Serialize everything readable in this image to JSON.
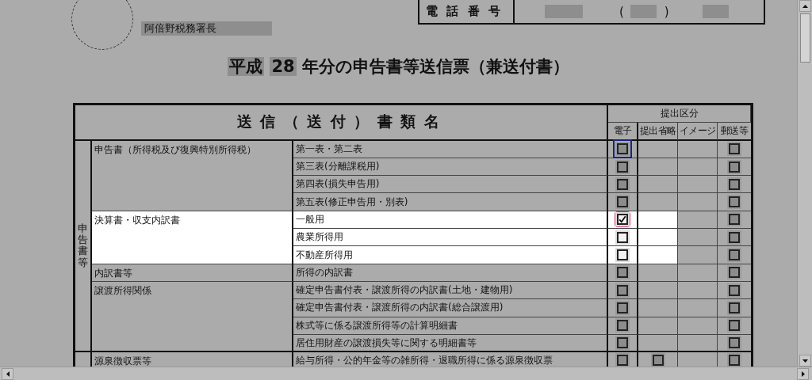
{
  "header": {
    "office": "阿倍野税務署長",
    "phone_label": "電話番号",
    "phone_open": "(",
    "phone_close": ")"
  },
  "title": {
    "era": "平成",
    "year": "28",
    "text": "年分の申告書等送信票（兼送付書）"
  },
  "table": {
    "name_header": "送信（送付）書類名",
    "submission_header": "提出区分",
    "columns": [
      "電子",
      "提出省略",
      "イメージ",
      "郵送等"
    ],
    "groups": [
      {
        "label": "申告書等",
        "categories": [
          {
            "name": "申告書（所得税及び復興特別所得税）",
            "highlighted": false,
            "rows": [
              {
                "name": "第一表・第二表",
                "e_filing": {
                  "checked": false,
                  "cursor": true,
                  "marked": false
                },
                "mail": {
                  "checked": false
                }
              },
              {
                "name": "第三表(分離課税用)",
                "e_filing": {
                  "checked": false,
                  "cursor": false,
                  "marked": false
                },
                "mail": {
                  "checked": false
                }
              },
              {
                "name": "第四表(損失申告用)",
                "e_filing": {
                  "checked": false,
                  "cursor": false,
                  "marked": false
                },
                "mail": {
                  "checked": false
                }
              },
              {
                "name": "第五表(修正申告用・別表)",
                "e_filing": {
                  "checked": false,
                  "cursor": false,
                  "marked": false
                },
                "mail": {
                  "checked": false
                }
              }
            ]
          },
          {
            "name": "決算書・収支内訳書",
            "highlighted": true,
            "rows": [
              {
                "name": "一般用",
                "e_filing": {
                  "checked": true,
                  "cursor": false,
                  "marked": true
                },
                "mail": {
                  "checked": false
                }
              },
              {
                "name": "農業所得用",
                "e_filing": {
                  "checked": false,
                  "cursor": false,
                  "marked": false
                },
                "mail": {
                  "checked": false
                }
              },
              {
                "name": "不動産所得用",
                "e_filing": {
                  "checked": false,
                  "cursor": false,
                  "marked": false
                },
                "mail": {
                  "checked": false
                }
              }
            ]
          },
          {
            "name": "内訳書等",
            "highlighted": false,
            "rows": [
              {
                "name": "所得の内訳書",
                "e_filing": {
                  "checked": false,
                  "cursor": false,
                  "marked": false
                },
                "mail": {
                  "checked": false
                }
              }
            ]
          },
          {
            "name": "譲渡所得関係",
            "highlighted": false,
            "rows": [
              {
                "name": "確定申告書付表・譲渡所得の内訳書(土地・建物用)",
                "e_filing": {
                  "checked": false,
                  "cursor": false,
                  "marked": false
                },
                "mail": {
                  "checked": false
                }
              },
              {
                "name": "確定申告書付表・譲渡所得の内訳書(総合譲渡用)",
                "e_filing": {
                  "checked": false,
                  "cursor": false,
                  "marked": false
                },
                "mail": {
                  "checked": false
                }
              },
              {
                "name": "株式等に係る譲渡所得等の計算明細書",
                "e_filing": {
                  "checked": false,
                  "cursor": false,
                  "marked": false
                },
                "mail": {
                  "checked": false
                }
              },
              {
                "name": "居住用財産の譲渡損失等に関する明細書等",
                "e_filing": {
                  "checked": false,
                  "cursor": false,
                  "marked": false
                },
                "mail": {
                  "checked": false
                }
              }
            ]
          }
        ]
      },
      {
        "categories": [
          {
            "name": "源泉徴収票等",
            "highlighted": false,
            "rows": [
              {
                "name": "給与所得・公的年金等の雑所得・退職所得に係る源泉徴収票",
                "e_filing": {
                  "checked": false,
                  "cursor": false,
                  "marked": false
                },
                "omission": {
                  "checked": false
                },
                "mail": {
                  "checked": false
                }
              }
            ]
          }
        ]
      }
    ]
  }
}
